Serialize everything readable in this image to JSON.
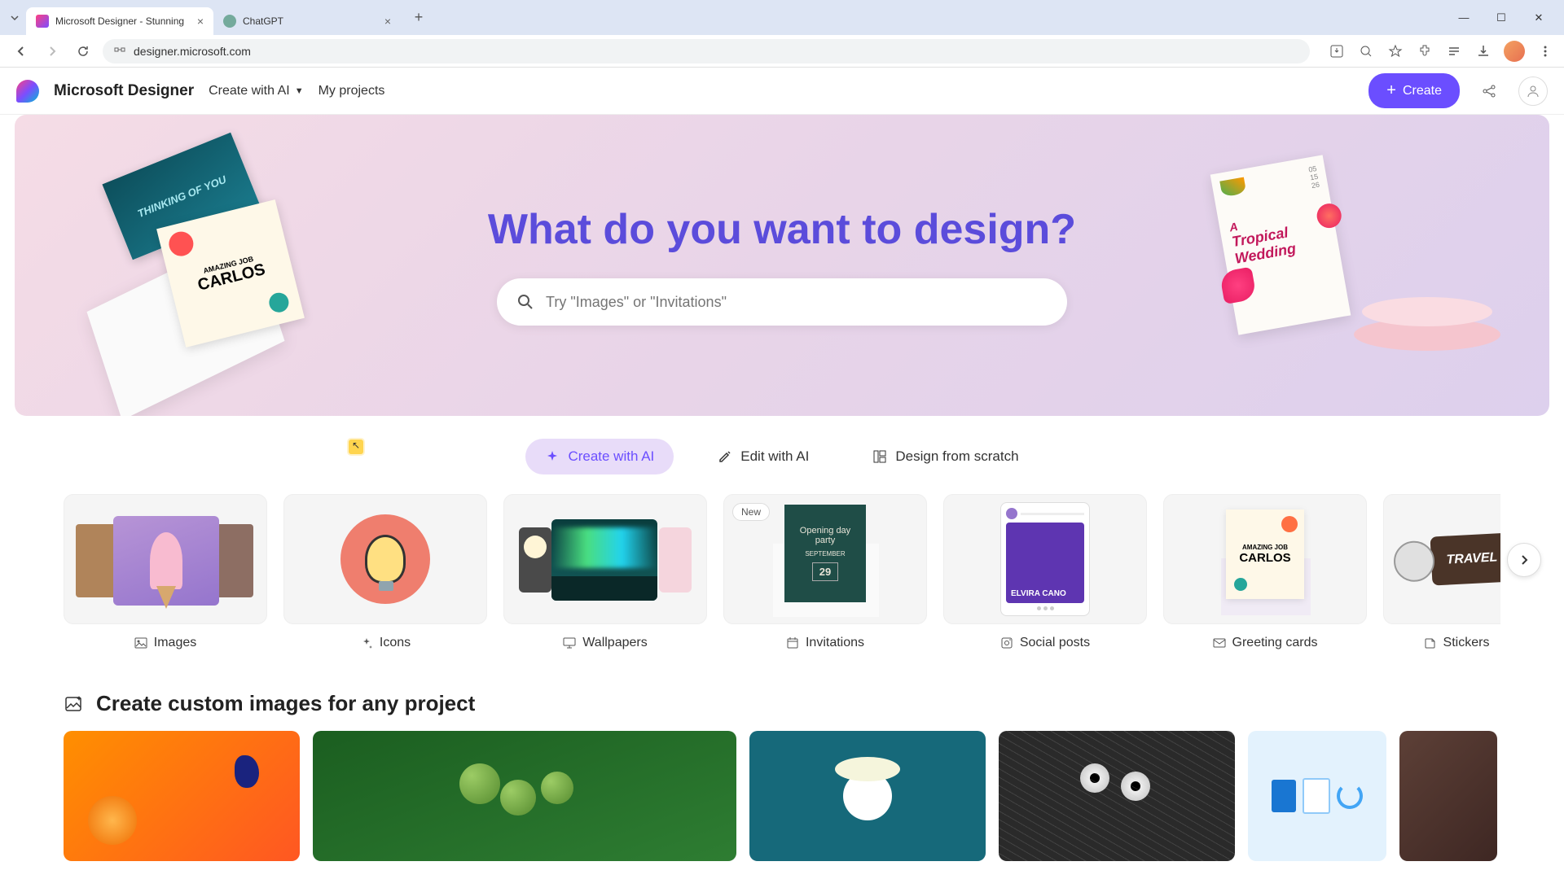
{
  "browser": {
    "tabs": [
      {
        "title": "Microsoft Designer - Stunning",
        "active": true
      },
      {
        "title": "ChatGPT",
        "active": false
      }
    ],
    "url": "designer.microsoft.com"
  },
  "header": {
    "brand": "Microsoft Designer",
    "nav": {
      "create_ai": "Create with AI",
      "projects": "My projects"
    },
    "create_button": "Create"
  },
  "hero": {
    "title": "What do you want to design?",
    "search_placeholder": "Try \"Images\" or \"Invitations\"",
    "art_left": {
      "thinking_text": "THINKING OF YOU",
      "carlos_top": "AMAZING JOB",
      "carlos_name": "CARLOS"
    },
    "art_right": {
      "tropical_a": "A",
      "tropical_title": "Tropical",
      "tropical_sub": "Wedding",
      "date1": "05",
      "date2": "15",
      "date3": "26"
    }
  },
  "mode_tabs": [
    {
      "label": "Create with AI",
      "active": true
    },
    {
      "label": "Edit with AI",
      "active": false
    },
    {
      "label": "Design from scratch",
      "active": false
    }
  ],
  "categories": [
    {
      "label": "Images",
      "badge": null
    },
    {
      "label": "Icons",
      "badge": null
    },
    {
      "label": "Wallpapers",
      "badge": null
    },
    {
      "label": "Invitations",
      "badge": "New",
      "card_title": "Opening day party",
      "card_date": "29"
    },
    {
      "label": "Social posts",
      "badge": null,
      "card_name": "ELVIRA CANO"
    },
    {
      "label": "Greeting cards",
      "badge": null,
      "gc_top": "AMAZING JOB",
      "gc_name": "CARLOS"
    },
    {
      "label": "Stickers",
      "badge": null,
      "sticker_text": "TRAVEL"
    }
  ],
  "section": {
    "title": "Create custom images for any project"
  }
}
